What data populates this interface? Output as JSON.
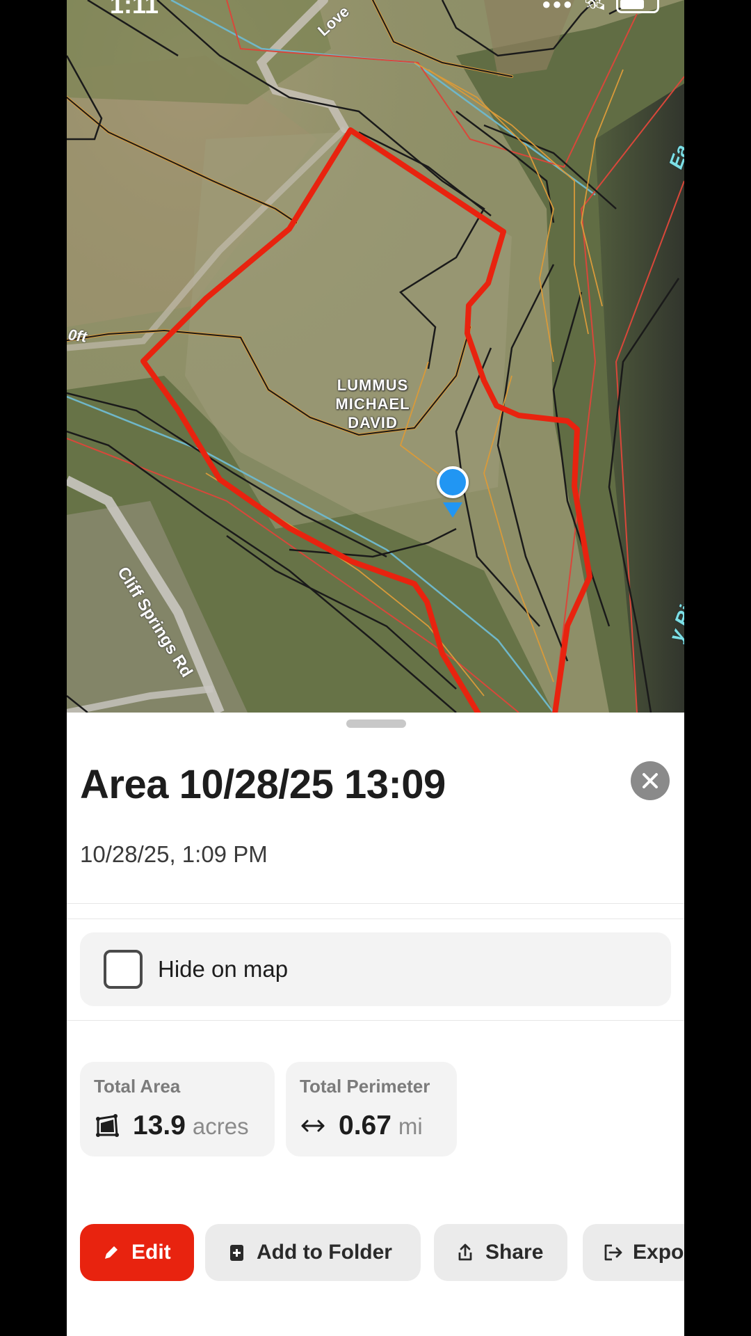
{
  "status_bar": {
    "time": "1:11"
  },
  "map": {
    "parcel_label": [
      "LUMMUS",
      "MICHAEL",
      "DAVID"
    ],
    "roads": {
      "cliff": "Cliff Springs Rd",
      "love": "Love"
    },
    "elevation_label": "0ft",
    "river_labels": {
      "lower": "y River",
      "upper": "Ea"
    },
    "colors": {
      "boundary": "#e8230f",
      "contour": "#1a1a1a",
      "contour_index": "#d99a3a",
      "property_line": "#d9473a",
      "water": "#6fb7c9",
      "location": "#2196f3"
    }
  },
  "sheet": {
    "title": "Area 10/28/25 13:09",
    "date": "10/28/25, 1:09 PM",
    "hide_on_map": {
      "label": "Hide on map",
      "checked": false
    },
    "stats": {
      "area": {
        "label": "Total Area",
        "value": "13.9",
        "unit": "acres",
        "icon": "area-polygon-icon"
      },
      "perimeter": {
        "label": "Total Perimeter",
        "value": "0.67",
        "unit": "mi",
        "icon": "arrows-horizontal-icon"
      }
    },
    "actions": {
      "edit": "Edit",
      "add_to_folder": "Add to Folder",
      "share": "Share",
      "export": "Expo"
    },
    "accent": "#e8230f"
  }
}
